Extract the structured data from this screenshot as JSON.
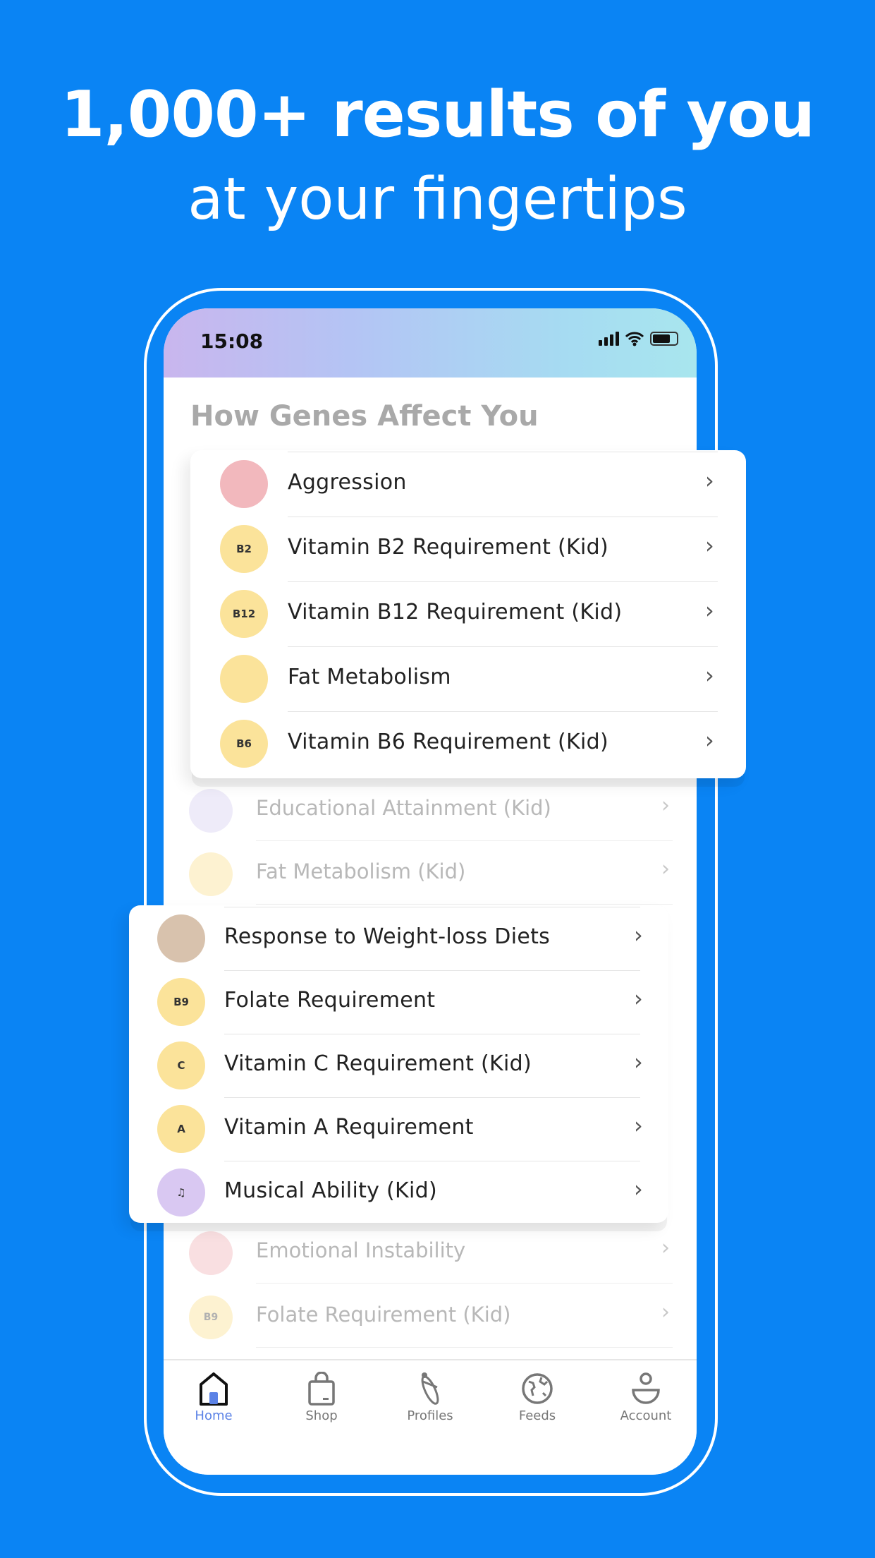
{
  "headline": {
    "line1": "1,000+ results of you",
    "line2": "at your fingertips"
  },
  "colors": {
    "background": "#0a84f4",
    "active_tab": "#5b82e6"
  },
  "status_bar": {
    "time": "15:08",
    "icons": [
      "signal-icon",
      "wifi-icon",
      "battery-icon"
    ]
  },
  "page_title": "How Genes Affect You",
  "card1": [
    {
      "label": "Aggression",
      "icon": "angry-face-icon",
      "badge": "",
      "color": "#f2b8bd"
    },
    {
      "label": "Vitamin B2 Requirement (Kid)",
      "icon": "vitamin-pill-icon",
      "badge": "B2",
      "color": "#fbe39a"
    },
    {
      "label": "Vitamin B12 Requirement (Kid)",
      "icon": "vitamin-pill-icon",
      "badge": "B12",
      "color": "#fbe39a"
    },
    {
      "label": "Fat Metabolism",
      "icon": "metabolism-cycle-icon",
      "badge": "",
      "color": "#fbe39a"
    },
    {
      "label": "Vitamin B6 Requirement (Kid)",
      "icon": "vitamin-pill-icon",
      "badge": "B6",
      "color": "#fbe39a"
    }
  ],
  "background_list": [
    {
      "label": "Educational Attainment (Kid)",
      "icon": "graduation-cap-icon",
      "color": "#d9d2f2"
    },
    {
      "label": "Fat Metabolism (Kid)",
      "icon": "metabolism-cycle-icon",
      "color": "#fbe39a"
    },
    {
      "label": "Emotional Instability",
      "icon": "faces-icon",
      "color": "#f2b8bd"
    },
    {
      "label": "Folate Requirement (Kid)",
      "icon": "vitamin-pill-icon",
      "badge": "B9",
      "color": "#fbe39a"
    }
  ],
  "card2": [
    {
      "label": "Response to Weight-loss Diets",
      "icon": "apple-scale-icon",
      "badge": "",
      "color": "#d8c2ad"
    },
    {
      "label": "Folate Requirement",
      "icon": "vitamin-pill-icon",
      "badge": "B9",
      "color": "#fbe39a"
    },
    {
      "label": "Vitamin C Requirement (Kid)",
      "icon": "vitamin-pill-icon",
      "badge": "C",
      "color": "#fbe39a"
    },
    {
      "label": "Vitamin A Requirement",
      "icon": "vitamin-pill-icon",
      "badge": "A",
      "color": "#fbe39a"
    },
    {
      "label": "Musical Ability (Kid)",
      "icon": "music-notes-icon",
      "badge": "♫",
      "color": "#d9c8f2"
    }
  ],
  "tabs": [
    {
      "label": "Home",
      "icon": "home-icon",
      "active": true
    },
    {
      "label": "Shop",
      "icon": "shopping-bag-icon",
      "active": false
    },
    {
      "label": "Profiles",
      "icon": "dna-person-icon",
      "active": false
    },
    {
      "label": "Feeds",
      "icon": "globe-icon",
      "active": false
    },
    {
      "label": "Account",
      "icon": "account-icon",
      "active": false
    }
  ]
}
